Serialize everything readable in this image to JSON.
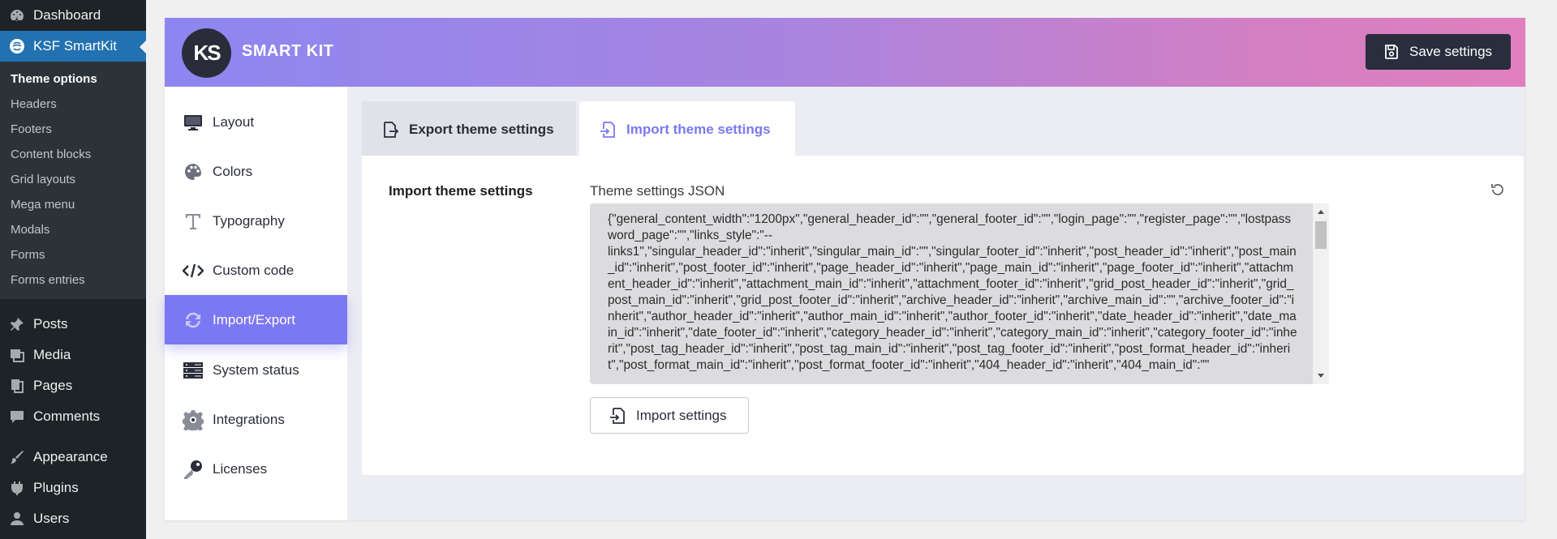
{
  "wp_menu": {
    "dashboard": "Dashboard",
    "ksf": "KSF SmartKit",
    "sub": [
      "Theme options",
      "Headers",
      "Footers",
      "Content blocks",
      "Grid layouts",
      "Mega menu",
      "Modals",
      "Forms",
      "Forms entries"
    ],
    "posts": "Posts",
    "media": "Media",
    "pages": "Pages",
    "comments": "Comments",
    "appearance": "Appearance",
    "plugins": "Plugins",
    "users": "Users"
  },
  "header": {
    "logo_text": "KS",
    "brand": "SMART KIT",
    "save_label": "Save settings"
  },
  "nav": {
    "items": [
      {
        "label": "Layout",
        "icon": "monitor-icon"
      },
      {
        "label": "Colors",
        "icon": "palette-icon"
      },
      {
        "label": "Typography",
        "icon": "type-icon"
      },
      {
        "label": "Custom code",
        "icon": "code-icon"
      },
      {
        "label": "Import/Export",
        "icon": "refresh-icon",
        "active": true
      },
      {
        "label": "System status",
        "icon": "server-icon"
      },
      {
        "label": "Integrations",
        "icon": "gear-icon"
      },
      {
        "label": "Licenses",
        "icon": "key-icon"
      }
    ]
  },
  "tabs": {
    "export": "Export theme settings",
    "import": "Import theme settings"
  },
  "panel": {
    "section_label": "Import theme settings",
    "json_label": "Theme settings JSON",
    "json_value": "{\"general_content_width\":\"1200px\",\"general_header_id\":\"\",\"general_footer_id\":\"\",\"login_page\":\"\",\"register_page\":\"\",\"lostpassword_page\":\"\",\"links_style\":\"--\nlinks1\",\"singular_header_id\":\"inherit\",\"singular_main_id\":\"\",\"singular_footer_id\":\"inherit\",\"post_header_id\":\"inherit\",\"post_main_id\":\"inherit\",\"post_footer_id\":\"inherit\",\"page_header_id\":\"inherit\",\"page_main_id\":\"inherit\",\"page_footer_id\":\"inherit\",\"attachment_header_id\":\"inherit\",\"attachment_main_id\":\"inherit\",\"attachment_footer_id\":\"inherit\",\"grid_post_header_id\":\"inherit\",\"grid_post_main_id\":\"inherit\",\"grid_post_footer_id\":\"inherit\",\"archive_header_id\":\"inherit\",\"archive_main_id\":\"\",\"archive_footer_id\":\"inherit\",\"author_header_id\":\"inherit\",\"author_main_id\":\"inherit\",\"author_footer_id\":\"inherit\",\"date_header_id\":\"inherit\",\"date_main_id\":\"inherit\",\"date_footer_id\":\"inherit\",\"category_header_id\":\"inherit\",\"category_main_id\":\"inherit\",\"category_footer_id\":\"inherit\",\"post_tag_header_id\":\"inherit\",\"post_tag_main_id\":\"inherit\",\"post_tag_footer_id\":\"inherit\",\"post_format_header_id\":\"inherit\",\"post_format_main_id\":\"inherit\",\"post_format_footer_id\":\"inherit\",\"404_header_id\":\"inherit\",\"404_main_id\":\"\"",
    "import_label": "Import settings"
  },
  "colors": {
    "accent": "#7b78f3",
    "wp_active": "#2271b1",
    "dark": "#2a2d3c"
  }
}
